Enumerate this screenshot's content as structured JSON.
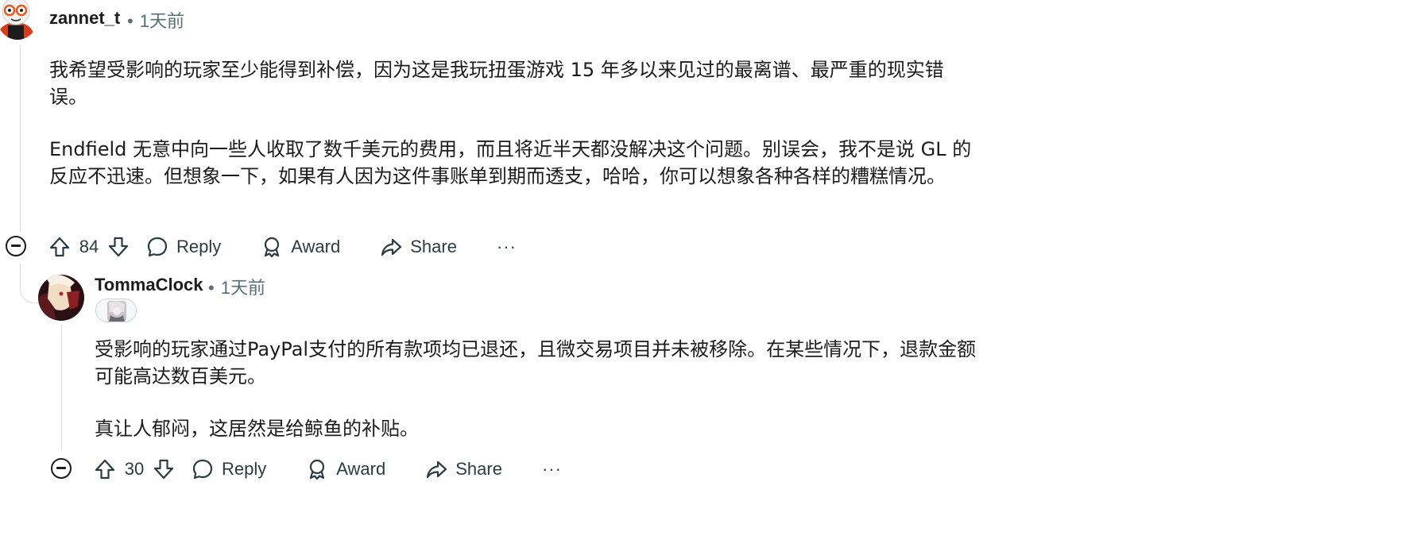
{
  "comments": [
    {
      "username": "zannet_t",
      "separator": "•",
      "timestamp": "1天前",
      "paragraphs": [
        "我希望受影响的玩家至少能得到补偿，因为这是我玩扭蛋游戏 15 年多以来见过的最离谱、最严重的现实错误。",
        "Endfield 无意中向一些人收取了数千美元的费用，而且将近半天都没解决这个问题。别误会，我不是说 GL 的反应不迅速。但想象一下，如果有人因为这件事账单到期而透支，哈哈，你可以想象各种各样的糟糕情况。"
      ],
      "score": "84",
      "reply_label": "Reply",
      "award_label": "Award",
      "share_label": "Share",
      "more_label": "···"
    },
    {
      "username": "TommaClock",
      "separator": "•",
      "timestamp": "1天前",
      "paragraphs": [
        "受影响的玩家通过PayPal支付的所有款项均已退还，且微交易项目并未被移除。在某些情况下，退款金额可能高达数百美元。",
        "真让人郁闷，这居然是给鲸鱼的补贴。"
      ],
      "score": "30",
      "reply_label": "Reply",
      "award_label": "Award",
      "share_label": "Share",
      "more_label": "···"
    }
  ],
  "icons": {
    "upvote": "arrow-up-icon",
    "downvote": "arrow-down-icon",
    "reply": "speech-bubble-icon",
    "award": "award-ribbon-icon",
    "share": "share-arrow-icon",
    "collapse": "minus-circle-icon"
  },
  "colors": {
    "text": "#1c1c1c",
    "meta": "#576f76",
    "action": "#2a3c42",
    "thread_line": "#d8dadc"
  }
}
